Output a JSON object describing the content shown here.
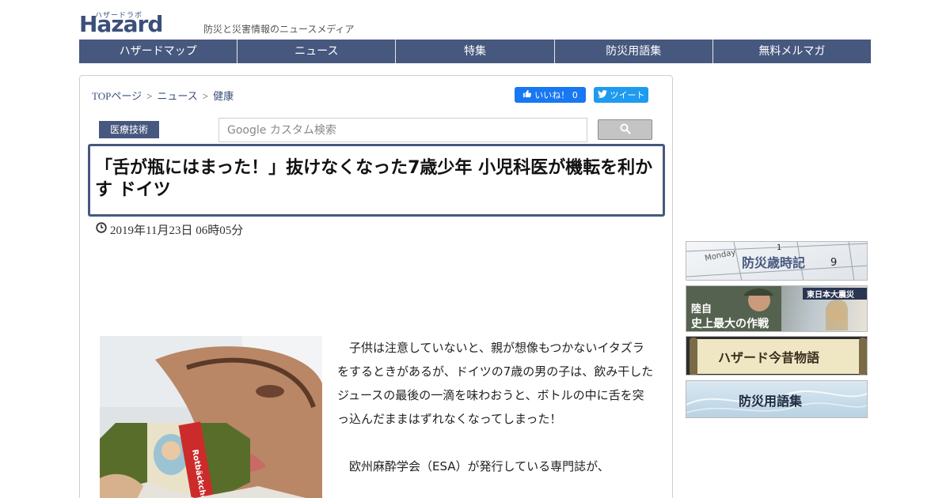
{
  "site": {
    "logo_kana": "ハザードラボ",
    "logo_text": "Hazard lab",
    "tagline": "防災と災害情報のニュースメディア"
  },
  "nav": [
    {
      "label": "ハザードマップ"
    },
    {
      "label": "ニュース"
    },
    {
      "label": "特集"
    },
    {
      "label": "防災用語集"
    },
    {
      "label": "無料メルマガ"
    }
  ],
  "breadcrumb": {
    "items": [
      "TOPページ",
      "ニュース",
      "健康"
    ],
    "separator": ">"
  },
  "social": {
    "like_label": "いいね！ 0",
    "tweet_label": "ツイート"
  },
  "category": "医療技術",
  "search": {
    "placeholder": "Google カスタム検索",
    "icon": "search-icon"
  },
  "article": {
    "title": "「舌が瓶にはまった！」抜けなくなった7歳少年 小児科医が機転を利かす ドイツ",
    "date": "2019年11月23日 06時05分",
    "paragraphs": [
      "子供は注意していないと、親が想像もつかないイタズラをするときがあるが、ドイツの7歳の男の子は、飲み干したジュースの最後の一滴を味わおうと、ボトルの中に舌を突っ込んだままはずれなくなってしまった！",
      "欧州麻酔学会（ESA）が発行している専門誌が、"
    ],
    "photo_bottle_label": "Rotbäckchen"
  },
  "sidebar": [
    {
      "label": "防災歳時記",
      "sub": "Monday"
    },
    {
      "label": "陸自 史上最大の作戦",
      "tag": "東日本大震災"
    },
    {
      "label": "ハザード今昔物語"
    },
    {
      "label": "防災用語集"
    }
  ],
  "colors": {
    "brand": "#47587f",
    "facebook": "#1877f2",
    "twitter": "#1d9bf0"
  }
}
